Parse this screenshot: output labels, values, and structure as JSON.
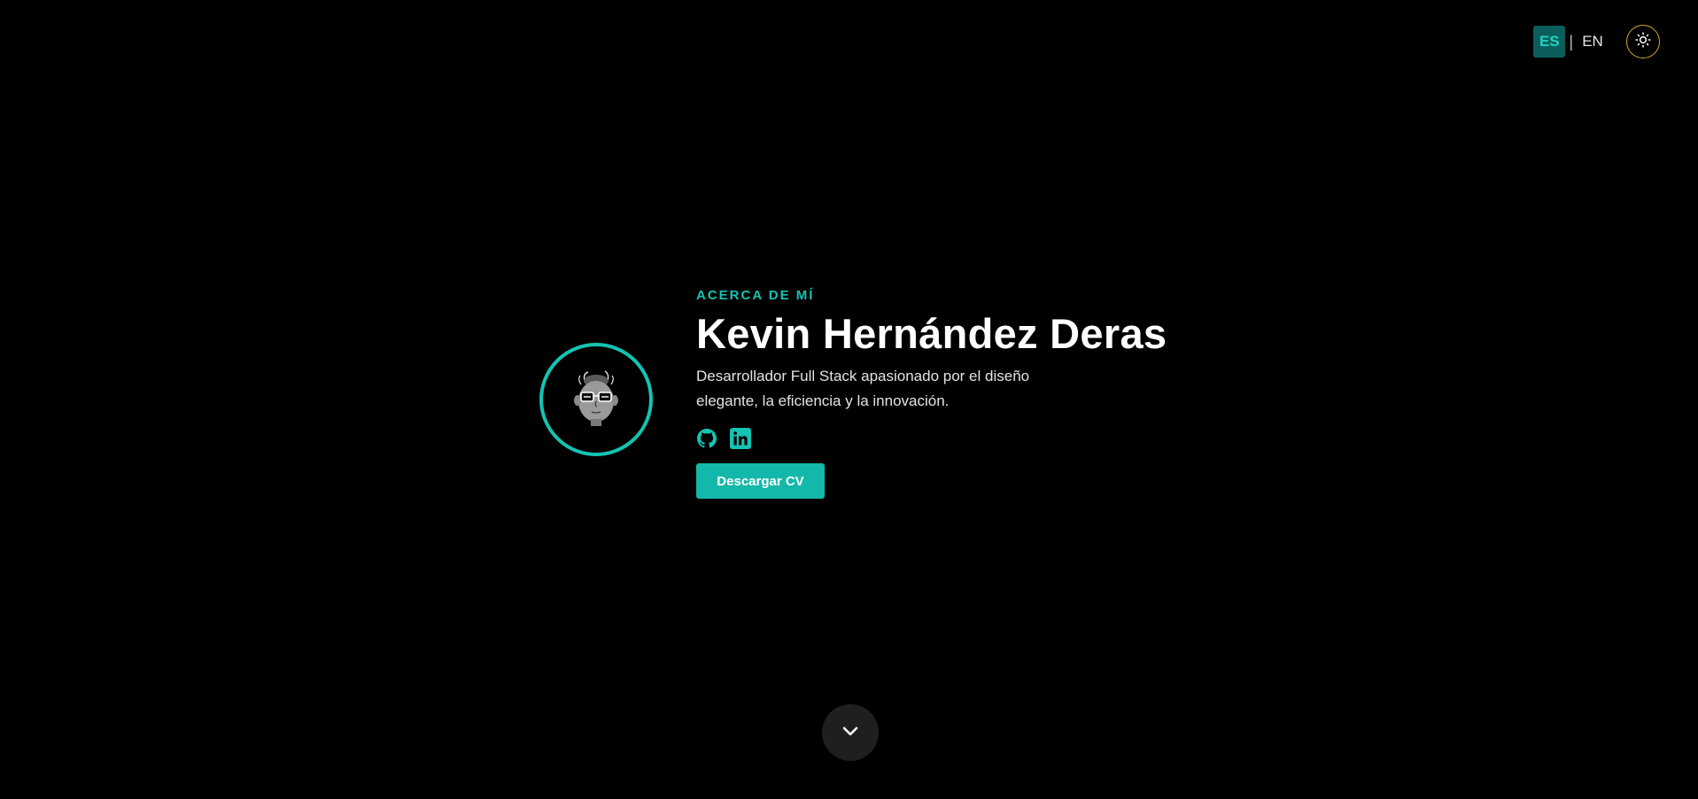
{
  "header": {
    "languages": [
      {
        "code": "ES",
        "active": true
      },
      {
        "code": "EN",
        "active": false
      }
    ],
    "separator": "|",
    "theme_icon": "sun-icon"
  },
  "hero": {
    "eyebrow": "ACERCA DE MÍ",
    "name": "Kevin Hernández Deras",
    "description": "Desarrollador Full Stack apasionado por el diseño elegante, la eficiencia y la innovación.",
    "avatar_icon": "cartoon-avatar",
    "socials": [
      {
        "icon": "github-icon"
      },
      {
        "icon": "linkedin-icon"
      }
    ],
    "cv_button": "Descargar CV"
  },
  "scroll": {
    "icon": "chevron-down-icon"
  },
  "colors": {
    "accent": "#14c3b3",
    "button": "#14b8aa",
    "background": "#000000",
    "theme_ring": "#d9a629"
  }
}
